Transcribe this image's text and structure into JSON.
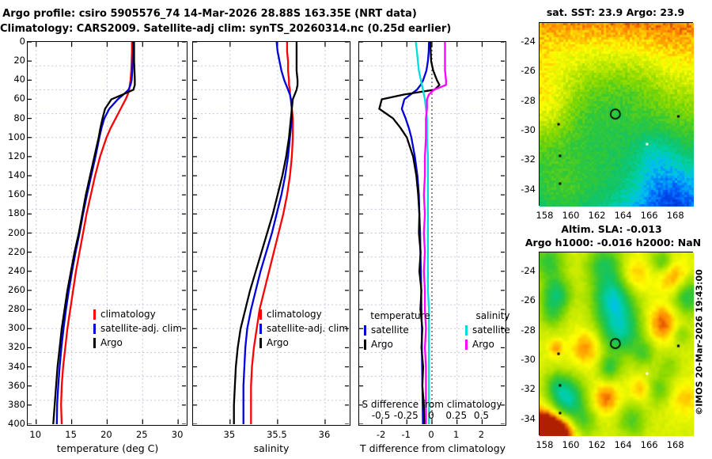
{
  "header": {
    "line1": "Argo profile: csiro 5905576_74 14-Mar-2026 28.88S 163.35E (NRT data)",
    "line2": "Climatology: CARS2009. Satellite-adj clim: synTS_20260314.nc (0.25d earlier)"
  },
  "watermark": "©IMOS 20-Mar-2026 19:43:00",
  "colors": {
    "climatology": "#ff0000",
    "satellite": "#0000dd",
    "argo": "#000000",
    "sal_satellite": "#00dddd",
    "sal_argo": "#ff00ff",
    "grid": "#c8c8dd",
    "zero_line": "#444444",
    "frame": "#000000"
  },
  "legends": {
    "climatology": "climatology",
    "satellite_adj": "satellite-adj. clim",
    "argo": "Argo",
    "temperature_header": "temperature",
    "salinity_header": "salinity",
    "satellite_short": "satellite"
  },
  "s_axis": {
    "label": "S difference from climatology",
    "tick_labels": [
      "-0.5",
      "-0.25",
      "0",
      "0.25",
      "0.5"
    ]
  },
  "map_titles": {
    "sst": "sat. SST: 23.9 Argo: 23.9",
    "sla": "Altim. SLA: -0.013",
    "sla2": "Argo h1000: -0.016 h2000: NaN"
  },
  "palette": [
    [
      0.0,
      "#0022cc"
    ],
    [
      0.12,
      "#0066ff"
    ],
    [
      0.22,
      "#00c0f0"
    ],
    [
      0.3,
      "#00d0a8"
    ],
    [
      0.4,
      "#10c468"
    ],
    [
      0.5,
      "#34c834"
    ],
    [
      0.62,
      "#86d800"
    ],
    [
      0.72,
      "#ccec00"
    ],
    [
      0.8,
      "#ffff00"
    ],
    [
      0.87,
      "#ffc000"
    ],
    [
      0.93,
      "#ff7f00"
    ],
    [
      1.0,
      "#b02000"
    ]
  ],
  "chart_data": [
    {
      "type": "line",
      "panel": "temperature",
      "xlabel": "temperature (deg C)",
      "xlim": [
        8.8,
        31.1
      ],
      "xticks": [
        10,
        15,
        20,
        25,
        30
      ],
      "xtick_labels": [
        "10",
        "15",
        "20",
        "25",
        "30"
      ],
      "depth_lim": [
        0,
        400
      ],
      "depth_ticks": [
        0,
        20,
        40,
        60,
        80,
        100,
        120,
        140,
        160,
        180,
        200,
        220,
        240,
        260,
        280,
        300,
        320,
        340,
        360,
        380,
        400
      ],
      "depths": [
        0,
        10,
        20,
        30,
        40,
        45,
        50,
        55,
        60,
        70,
        80,
        90,
        100,
        120,
        140,
        160,
        180,
        200,
        220,
        240,
        260,
        280,
        300,
        320,
        340,
        360,
        380,
        400
      ],
      "series": [
        {
          "name": "climatology",
          "color": "climatology",
          "values": [
            23.5,
            23.5,
            23.45,
            23.4,
            23.3,
            23.2,
            23.1,
            22.9,
            22.6,
            21.9,
            21.2,
            20.5,
            19.9,
            19.0,
            18.3,
            17.7,
            17.1,
            16.6,
            16.1,
            15.6,
            15.2,
            14.8,
            14.4,
            14.1,
            13.8,
            13.6,
            13.5,
            13.6
          ]
        },
        {
          "name": "satellite-adj. clim",
          "color": "satellite",
          "values": [
            23.65,
            23.65,
            23.6,
            23.55,
            23.45,
            23.3,
            23.0,
            22.3,
            21.5,
            20.3,
            19.6,
            19.2,
            18.9,
            18.35,
            17.75,
            17.15,
            16.6,
            16.1,
            15.55,
            15.05,
            14.6,
            14.2,
            13.85,
            13.55,
            13.3,
            13.1,
            12.95,
            12.9
          ]
        },
        {
          "name": "Argo",
          "color": "argo",
          "values": [
            23.8,
            23.8,
            23.8,
            23.85,
            23.9,
            23.9,
            23.7,
            22.2,
            20.6,
            19.7,
            19.35,
            19.05,
            18.8,
            18.2,
            17.6,
            17.0,
            16.5,
            16.0,
            15.4,
            14.9,
            14.4,
            14.0,
            13.6,
            13.3,
            13.0,
            12.8,
            12.6,
            12.4
          ]
        }
      ]
    },
    {
      "type": "line",
      "panel": "salinity",
      "xlabel": "salinity",
      "xlim": [
        34.61,
        36.25
      ],
      "xticks": [
        35,
        35.5,
        36
      ],
      "xtick_labels": [
        "35",
        "35.5",
        "36"
      ],
      "depth_lim": [
        0,
        400
      ],
      "depths": [
        0,
        10,
        20,
        30,
        40,
        45,
        50,
        55,
        60,
        70,
        80,
        90,
        100,
        120,
        140,
        160,
        180,
        200,
        220,
        240,
        260,
        280,
        300,
        320,
        340,
        360,
        380,
        400
      ],
      "series": [
        {
          "name": "climatology",
          "color": "climatology",
          "values": [
            35.6,
            35.6,
            35.61,
            35.61,
            35.62,
            35.62,
            35.63,
            35.63,
            35.64,
            35.65,
            35.66,
            35.66,
            35.66,
            35.65,
            35.63,
            35.6,
            35.56,
            35.51,
            35.46,
            35.41,
            35.36,
            35.31,
            35.28,
            35.25,
            35.23,
            35.22,
            35.22,
            35.22
          ]
        },
        {
          "name": "satellite-adj. clim",
          "color": "satellite",
          "values": [
            35.49,
            35.5,
            35.52,
            35.54,
            35.57,
            35.59,
            35.61,
            35.63,
            35.64,
            35.65,
            35.65,
            35.64,
            35.63,
            35.61,
            35.58,
            35.54,
            35.49,
            35.44,
            35.38,
            35.32,
            35.27,
            35.22,
            35.18,
            35.16,
            35.15,
            35.14,
            35.14,
            35.14
          ]
        },
        {
          "name": "Argo",
          "color": "argo",
          "values": [
            35.7,
            35.7,
            35.7,
            35.7,
            35.71,
            35.71,
            35.7,
            35.68,
            35.66,
            35.65,
            35.64,
            35.63,
            35.62,
            35.59,
            35.55,
            35.5,
            35.45,
            35.39,
            35.33,
            35.27,
            35.21,
            35.16,
            35.11,
            35.08,
            35.06,
            35.05,
            35.04,
            35.04
          ]
        }
      ]
    },
    {
      "type": "line",
      "panel": "difference",
      "xlabel": "T difference from climatology",
      "s_axis_label": "S difference from climatology",
      "xlim": [
        -2.9,
        2.9
      ],
      "xticks": [
        -2,
        -1,
        0,
        1,
        2
      ],
      "xtick_labels": [
        "-2",
        "-1",
        "0",
        "1",
        "2"
      ],
      "s_ticks": [
        -0.5,
        -0.25,
        0,
        0.25,
        0.5
      ],
      "s_scale": 4,
      "zero_dotted": true,
      "depth_lim": [
        0,
        400
      ],
      "depths": [
        0,
        10,
        20,
        30,
        40,
        45,
        50,
        55,
        60,
        70,
        80,
        90,
        100,
        120,
        140,
        160,
        180,
        200,
        220,
        240,
        260,
        280,
        300,
        320,
        340,
        360,
        380,
        400
      ],
      "series": [
        {
          "name": "temperature satellite",
          "color": "satellite",
          "scale": 1,
          "values": [
            -0.12,
            -0.13,
            -0.16,
            -0.22,
            -0.35,
            -0.45,
            -0.6,
            -0.85,
            -1.1,
            -1.2,
            -1.05,
            -0.92,
            -0.82,
            -0.68,
            -0.58,
            -0.52,
            -0.5,
            -0.47,
            -0.46,
            -0.44,
            -0.43,
            -0.42,
            -0.4,
            -0.4,
            -0.39,
            -0.38,
            -0.37,
            -0.36
          ]
        },
        {
          "name": "temperature Argo",
          "color": "argo",
          "scale": 1,
          "values": [
            -0.06,
            -0.05,
            -0.03,
            0.05,
            0.2,
            0.3,
            0.1,
            -1.1,
            -2.0,
            -2.1,
            -1.55,
            -1.25,
            -1.0,
            -0.75,
            -0.62,
            -0.55,
            -0.5,
            -0.52,
            -0.45,
            -0.5,
            -0.42,
            -0.46,
            -0.38,
            -0.42,
            -0.35,
            -0.38,
            -0.32,
            -0.3
          ]
        },
        {
          "name": "salinity satellite",
          "color": "sal_satellite",
          "scale": 4,
          "values": [
            -0.16,
            -0.15,
            -0.14,
            -0.13,
            -0.11,
            -0.1,
            -0.09,
            -0.08,
            -0.07,
            -0.06,
            -0.05,
            -0.05,
            -0.05,
            -0.04,
            -0.04,
            -0.04,
            -0.04,
            -0.04,
            -0.04,
            -0.04,
            -0.04,
            -0.03,
            -0.03,
            -0.03,
            -0.03,
            -0.03,
            -0.03,
            -0.03
          ]
        },
        {
          "name": "salinity Argo",
          "color": "sal_argo",
          "scale": 4,
          "values": [
            0.13,
            0.13,
            0.13,
            0.13,
            0.14,
            0.14,
            0.02,
            -0.03,
            -0.05,
            -0.05,
            -0.06,
            -0.06,
            -0.06,
            -0.07,
            -0.07,
            -0.08,
            -0.07,
            -0.08,
            -0.07,
            -0.08,
            -0.07,
            -0.07,
            -0.06,
            -0.07,
            -0.06,
            -0.06,
            -0.06,
            -0.06
          ]
        }
      ]
    },
    {
      "type": "heatmap",
      "name": "sst_map",
      "title": "sat. SST: 23.9 Argo: 23.9",
      "lon_range": [
        157.55,
        169.35
      ],
      "lat_range": [
        -22.7,
        -35.15
      ],
      "lon_ticks": [
        158,
        160,
        162,
        164,
        166,
        168
      ],
      "lat_ticks": [
        -24,
        -26,
        -28,
        -30,
        -32,
        -34
      ],
      "argo_marker": {
        "lon": 163.35,
        "lat": -28.88
      },
      "land_dots": [
        [
          0.123,
          0.552,
          "#000000"
        ],
        [
          0.133,
          0.724,
          "#000000"
        ],
        [
          0.133,
          0.875,
          "#000000"
        ],
        [
          0.697,
          0.66,
          "#ffffff"
        ],
        [
          0.9,
          0.509,
          "#000000"
        ]
      ],
      "render": {
        "pixelated": true,
        "noise": 0.045,
        "base_top": 0.91,
        "base_bottom": 0.3,
        "blobs": [
          [
            0.5,
            0.03,
            0.35,
            0.03
          ],
          [
            0.02,
            0.45,
            0.22,
            0.2
          ],
          [
            0.35,
            0.45,
            0.33,
            -0.13
          ],
          [
            0.62,
            0.33,
            0.2,
            -0.06
          ],
          [
            0.85,
            0.97,
            0.28,
            -0.24
          ],
          [
            0.75,
            0.7,
            0.14,
            -0.1
          ],
          [
            0.12,
            0.95,
            0.22,
            0.16
          ],
          [
            0.45,
            0.88,
            0.25,
            0.08
          ],
          [
            0.9,
            0.15,
            0.18,
            0.03
          ]
        ]
      }
    },
    {
      "type": "heatmap",
      "name": "sla_map",
      "title": "Altim. SLA: -0.013",
      "subtitle": "Argo h1000: -0.016 h2000: NaN",
      "lon_range": [
        157.55,
        169.35
      ],
      "lat_range": [
        -22.7,
        -35.15
      ],
      "lon_ticks": [
        158,
        160,
        162,
        164,
        166,
        168
      ],
      "lat_ticks": [
        -24,
        -26,
        -28,
        -30,
        -32,
        -34
      ],
      "argo_marker": {
        "lon": 163.35,
        "lat": -28.88
      },
      "land_dots": [
        [
          0.123,
          0.552,
          "#000000"
        ],
        [
          0.133,
          0.724,
          "#000000"
        ],
        [
          0.133,
          0.875,
          "#000000"
        ],
        [
          0.697,
          0.66,
          "#ffffff"
        ],
        [
          0.9,
          0.509,
          "#000000"
        ]
      ],
      "render": {
        "pixelated": false,
        "noise": 0.02,
        "base_top": 0.74,
        "base_bottom": 0.74,
        "blobs": [
          [
            0.05,
            0.04,
            0.1,
            -0.25
          ],
          [
            0.1,
            0.22,
            0.09,
            -0.33
          ],
          [
            0.07,
            0.33,
            0.08,
            -0.18
          ],
          [
            0.42,
            0.06,
            0.11,
            -0.28
          ],
          [
            0.47,
            0.24,
            0.12,
            -0.36
          ],
          [
            0.53,
            0.43,
            0.13,
            -0.34
          ],
          [
            0.5,
            0.33,
            0.15,
            -0.12
          ],
          [
            0.8,
            0.04,
            0.07,
            -0.22
          ],
          [
            0.97,
            0.23,
            0.1,
            -0.3
          ],
          [
            0.88,
            0.13,
            0.1,
            0.2
          ],
          [
            0.62,
            0.12,
            0.1,
            0.14
          ],
          [
            0.8,
            0.38,
            0.1,
            0.22
          ],
          [
            0.3,
            0.52,
            0.1,
            0.18
          ],
          [
            0.1,
            0.52,
            0.05,
            0.16
          ],
          [
            0.45,
            0.63,
            0.07,
            -0.24
          ],
          [
            0.68,
            0.55,
            0.07,
            -0.18
          ],
          [
            0.85,
            0.62,
            0.07,
            -0.12
          ],
          [
            0.43,
            0.8,
            0.09,
            0.2
          ],
          [
            0.17,
            0.8,
            0.11,
            -0.45
          ],
          [
            0.1,
            0.72,
            0.07,
            -0.15
          ],
          [
            0.28,
            0.93,
            0.09,
            -0.18
          ],
          [
            0.6,
            0.92,
            0.09,
            -0.2
          ],
          [
            0.78,
            0.75,
            0.08,
            -0.18
          ],
          [
            0.95,
            0.8,
            0.1,
            0.12
          ],
          [
            0.66,
            0.75,
            0.07,
            0.14
          ],
          [
            0.02,
            0.98,
            0.12,
            0.5
          ],
          [
            0.14,
            1.0,
            0.1,
            0.28
          ],
          [
            0.93,
            0.45,
            0.06,
            -0.12
          ]
        ]
      }
    }
  ]
}
